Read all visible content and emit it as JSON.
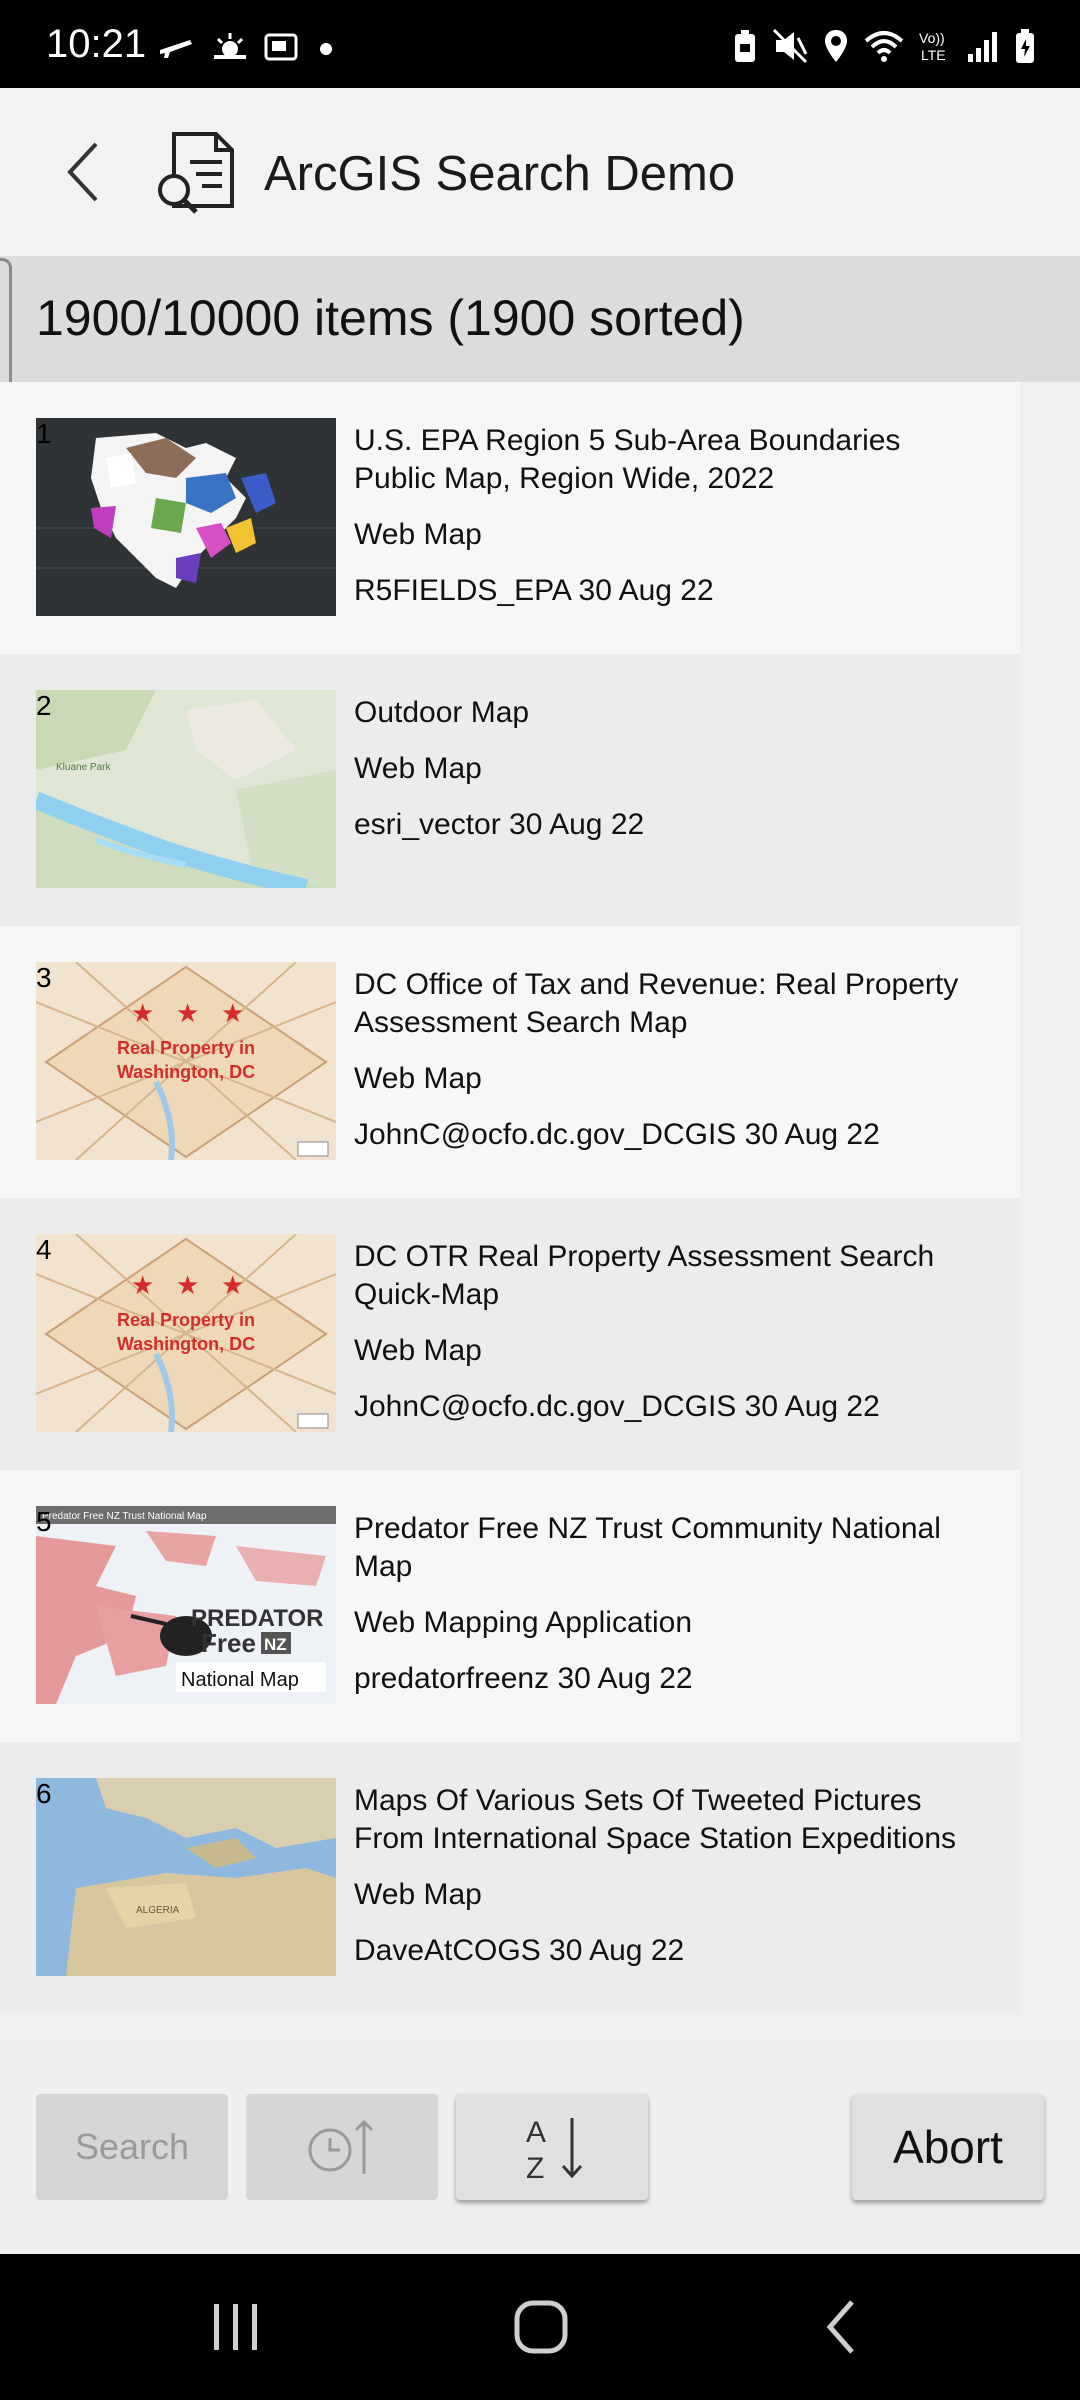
{
  "status": {
    "time": "10:21",
    "volte": "Vo))\nLTE"
  },
  "header": {
    "title": "ArcGIS Search Demo"
  },
  "summary": {
    "count_text": "1900/10000 items (1900 sorted)"
  },
  "items": [
    {
      "index": "1",
      "title": "U.S. EPA Region 5 Sub-Area Boundaries Public Map, Region Wide, 2022",
      "type": "Web Map",
      "owner_date": "R5FIELDS_EPA 30 Aug 22"
    },
    {
      "index": "2",
      "title": "Outdoor Map",
      "type": "Web Map",
      "owner_date": "esri_vector 30 Aug 22"
    },
    {
      "index": "3",
      "title": "DC Office of Tax and Revenue: Real Property Assessment Search Map",
      "type": "Web Map",
      "owner_date": "JohnC@ocfo.dc.gov_DCGIS 30 Aug 22"
    },
    {
      "index": "4",
      "title": "DC OTR Real Property Assessment Search Quick-Map",
      "type": "Web Map",
      "owner_date": "JohnC@ocfo.dc.gov_DCGIS 30 Aug 22"
    },
    {
      "index": "5",
      "title": "Predator Free NZ Trust Community National Map",
      "type": "Web Mapping Application",
      "owner_date": "predatorfreenz 30 Aug 22"
    },
    {
      "index": "6",
      "title": "Maps Of Various Sets Of Tweeted Pictures From International Space Station Expeditions",
      "type": "Web Map",
      "owner_date": "DaveAtCOGS 30 Aug 22"
    }
  ],
  "thumbnails": {
    "thumb3_line1": "Real Property in",
    "thumb3_line2": "Washington, DC",
    "thumb4_line1": "Real Property in",
    "thumb4_line2": "Washington, DC",
    "thumb5_header": "Predator Free NZ Trust National Map",
    "thumb5_brand1": "PREDATOR",
    "thumb5_brand2": "Free",
    "thumb5_brand3": "NZ",
    "thumb5_caption": "National Map",
    "thumb2_label": "Kluane Park",
    "thumb6_label": "ALGERIA"
  },
  "toolbar": {
    "search_label": "Search",
    "sort_az_top": "A",
    "sort_az_bottom": "Z",
    "abort_label": "Abort"
  },
  "colors": {
    "status_bg": "#000000",
    "appbar_bg": "#f2f2f2",
    "countbar_bg": "#dcdcdc",
    "row_light": "#f7f7f7",
    "row_dark": "#ececec"
  }
}
